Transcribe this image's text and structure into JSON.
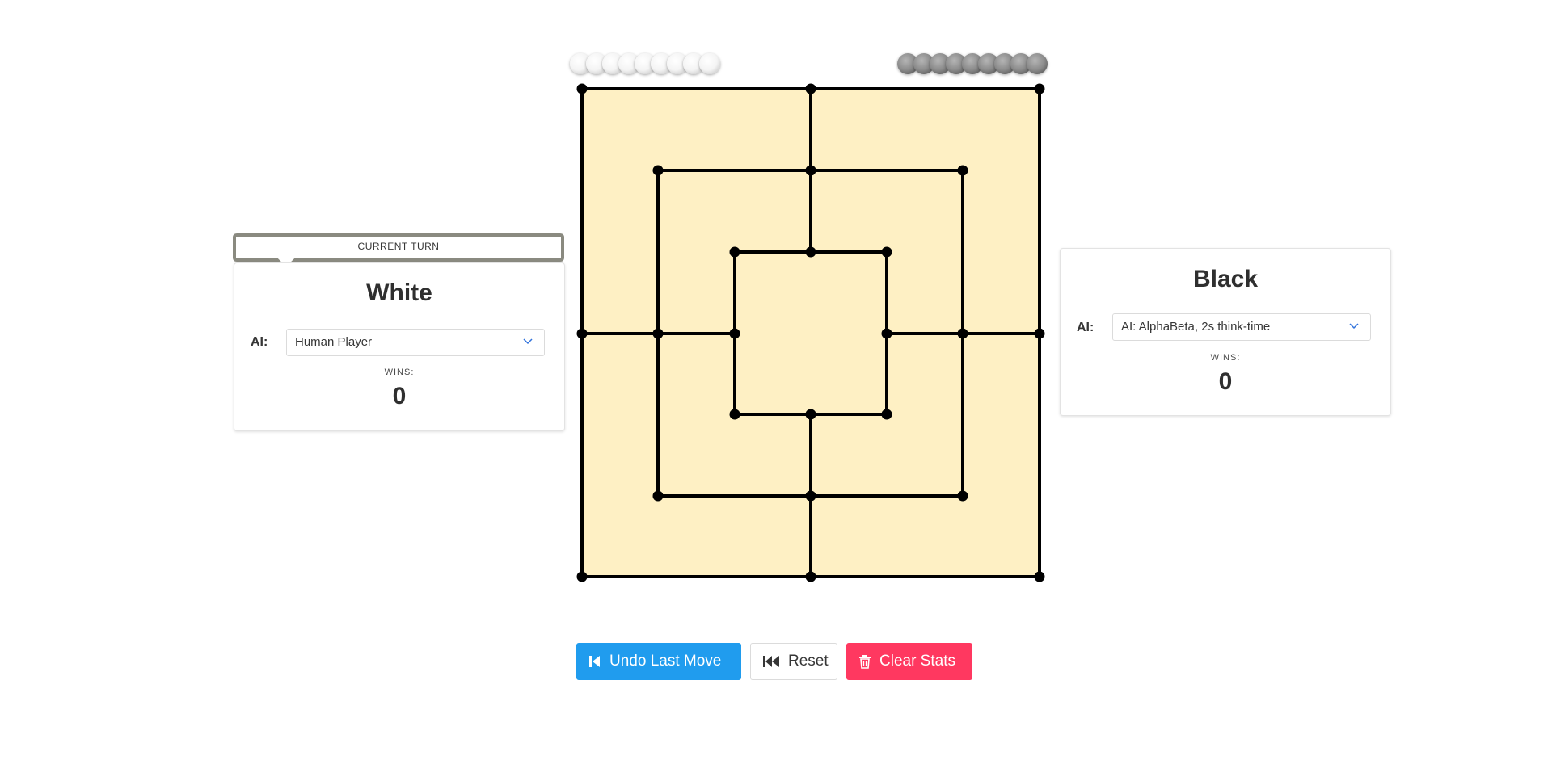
{
  "game": "Nine Men's Morris",
  "current_turn_label": "CURRENT TURN",
  "players": {
    "white": {
      "name": "White",
      "ai_label": "AI:",
      "ai_selected": "Human Player",
      "wins_label": "WINS:",
      "wins": "0",
      "pieces_in_hand": 9
    },
    "black": {
      "name": "Black",
      "ai_label": "AI:",
      "ai_selected": "AI: AlphaBeta, 2s think-time",
      "wins_label": "WINS:",
      "wins": "0",
      "pieces_in_hand": 9
    }
  },
  "board": {
    "background_color": "#fef0c4",
    "line_color": "#000000"
  },
  "buttons": {
    "undo": "Undo Last Move",
    "reset": "Reset",
    "clear": "Clear Stats"
  },
  "colors": {
    "undo": "#209cee",
    "clear": "#ff3860",
    "turn_badge_border": "#8a8a80"
  },
  "icons": {
    "undo": "step-backward-icon",
    "reset": "fast-backward-icon",
    "clear": "trash-icon",
    "select": "chevron-down-icon"
  }
}
